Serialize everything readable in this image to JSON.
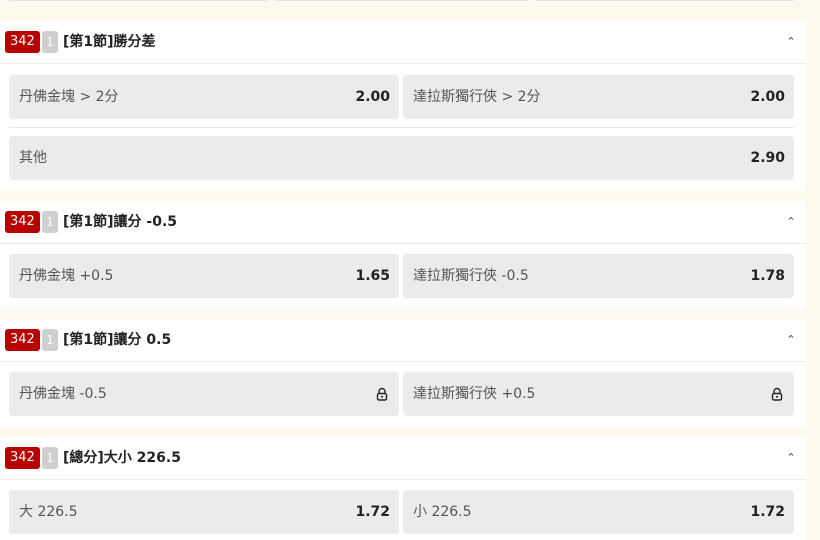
{
  "markets": [
    {
      "event_id": "342",
      "period": "1",
      "title": "[第1節]勝分差",
      "rows": [
        [
          {
            "name": "丹佛金塊 > 2分",
            "odds": "2.00",
            "locked": false
          },
          {
            "name": "達拉斯獨行俠 > 2分",
            "odds": "2.00",
            "locked": false
          }
        ],
        [
          {
            "name": "其他",
            "odds": "2.90",
            "locked": false
          }
        ]
      ]
    },
    {
      "event_id": "342",
      "period": "1",
      "title": "[第1節]讓分 -0.5",
      "rows": [
        [
          {
            "name": "丹佛金塊 +0.5",
            "odds": "1.65",
            "locked": false
          },
          {
            "name": "達拉斯獨行俠 -0.5",
            "odds": "1.78",
            "locked": false
          }
        ]
      ]
    },
    {
      "event_id": "342",
      "period": "1",
      "title": "[第1節]讓分 0.5",
      "rows": [
        [
          {
            "name": "丹佛金塊 -0.5",
            "odds": "",
            "locked": true
          },
          {
            "name": "達拉斯獨行俠 +0.5",
            "odds": "",
            "locked": true
          }
        ]
      ]
    },
    {
      "event_id": "342",
      "period": "1",
      "title": "[總分]大小 226.5",
      "rows": [
        [
          {
            "name": "大 226.5",
            "odds": "1.72",
            "locked": false
          },
          {
            "name": "小 226.5",
            "odds": "1.72",
            "locked": false
          }
        ]
      ]
    }
  ],
  "icons": {
    "collapse": "chevron-up-icon",
    "locked": "lock-icon"
  },
  "colors": {
    "event_badge": "#b80000",
    "period_badge": "#cfcfcf",
    "selection_bg": "#ebebeb",
    "page_bg": "#fdf9ee"
  }
}
